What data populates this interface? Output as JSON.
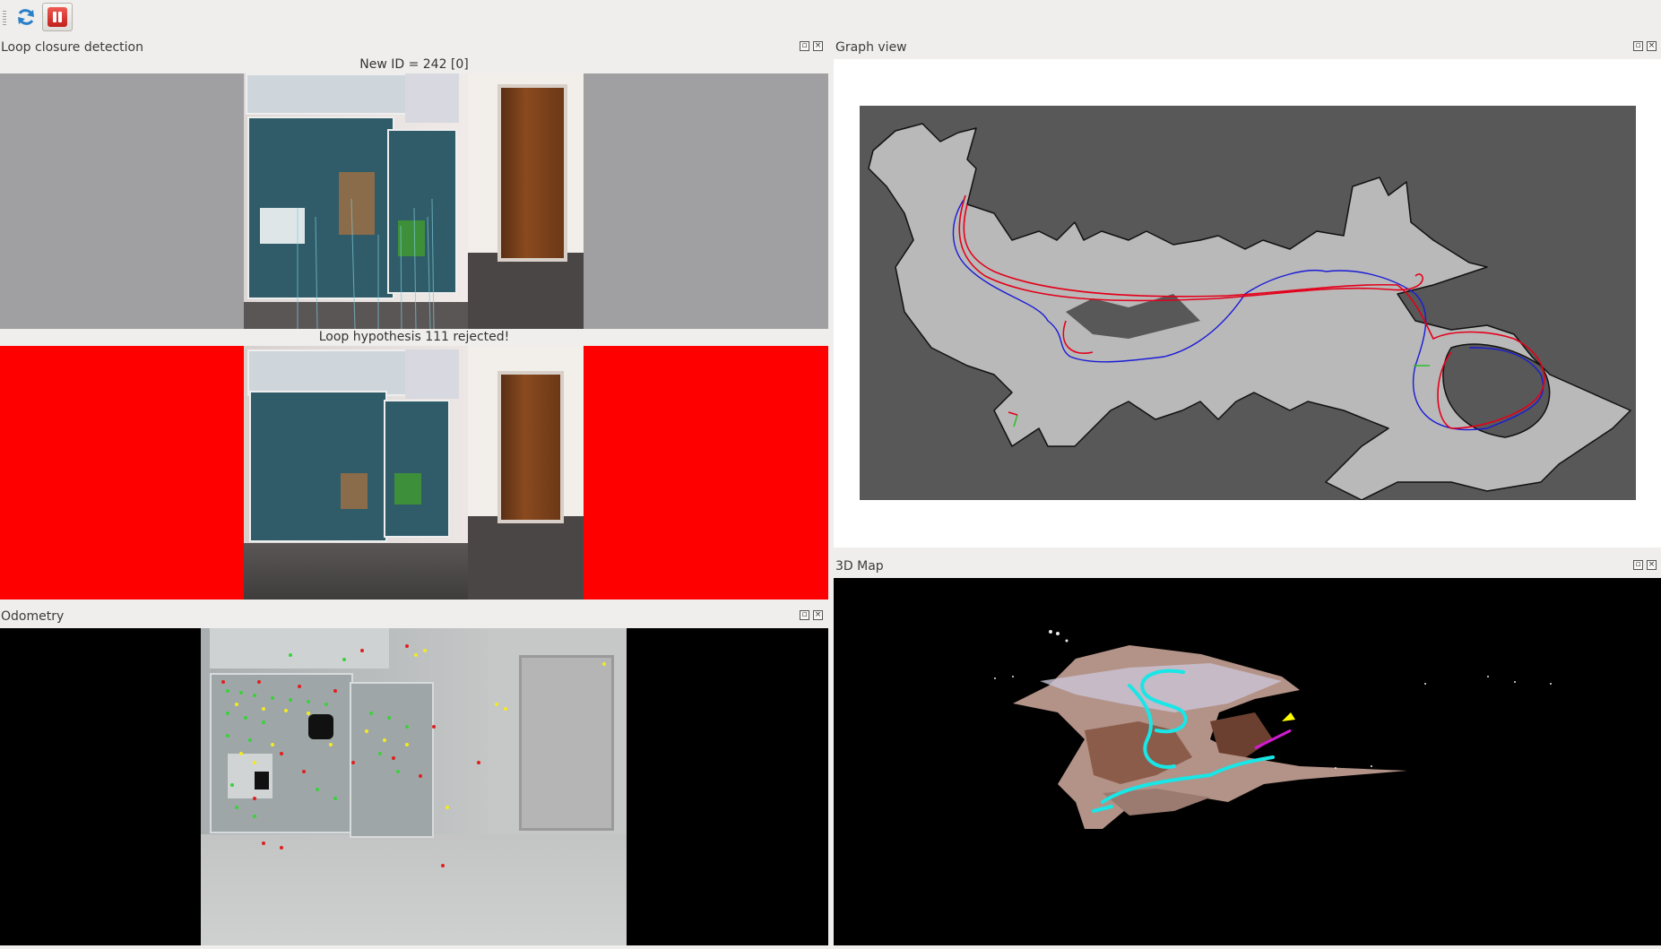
{
  "toolbar": {
    "refresh_icon": "refresh-icon",
    "pause_icon": "pause-icon"
  },
  "docks": {
    "loop_closure": {
      "title": "Loop closure detection",
      "new_id_label": "New ID = 242 [0]",
      "hypothesis_label": "Loop hypothesis 111 rejected!"
    },
    "graph_view": {
      "title": "Graph view"
    },
    "map3d": {
      "title": "3D Map"
    },
    "odometry": {
      "title": "Odometry"
    }
  },
  "dock_button_glyphs": {
    "float": "▫",
    "close": "×"
  },
  "colors": {
    "rejected": "#ff0000",
    "trajectory_red": "#e3001b",
    "trajectory_blue": "#1a1ad8",
    "feature_inlier": "#3bd13b",
    "feature_yellow": "#f2ea20",
    "feature_red": "#e02020"
  }
}
